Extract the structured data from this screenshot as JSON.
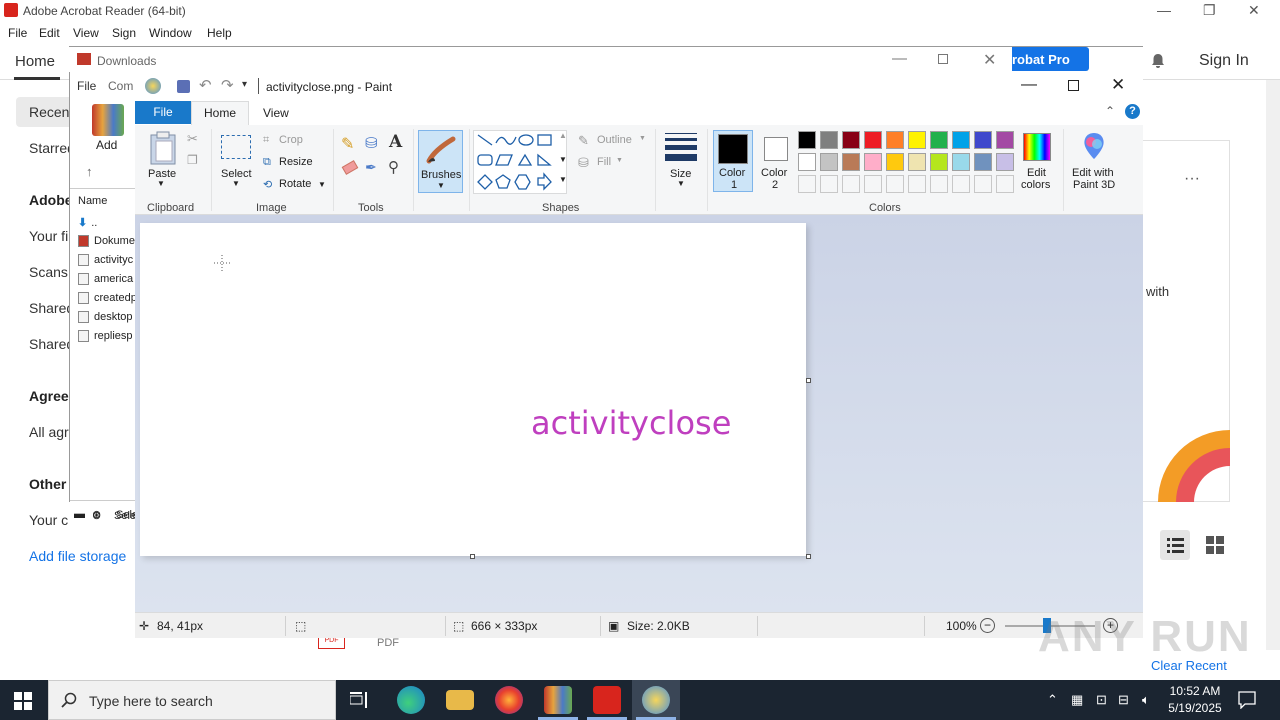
{
  "acrobat": {
    "window_title": "Adobe Acrobat Reader (64-bit)",
    "menu": [
      "File",
      "Edit",
      "View",
      "Sign",
      "Window",
      "Help"
    ],
    "home_tab": "Home",
    "try_pro": "robat Pro",
    "sign_in": "Sign In",
    "sidebar": {
      "recent": "Recent",
      "starred": "Starred",
      "adobe_head": "Adobe",
      "your_files": "Your fi",
      "scans": "Scans",
      "shared1": "Shared",
      "shared2": "Shared",
      "agree_head": "Agree",
      "all_agree": "All agr",
      "other_head": "Other",
      "your_c": "Your c",
      "add_storage": "Add file storage"
    },
    "right_text": "with",
    "more": "···",
    "clear_recent": "Clear Recent",
    "pdf_badge": "PDF",
    "pdf_label": "PDF"
  },
  "explorer": {
    "title": "Downloads",
    "menu_file": "File",
    "menu_com": "Com",
    "add_label": "Add",
    "name_header": "Name",
    "rows": [
      "..",
      "Dokume",
      "activityc",
      "america",
      "createdp",
      "desktop",
      "repliesp"
    ],
    "status": "Sele"
  },
  "paint": {
    "title": "activityclose.png - Paint",
    "tabs": {
      "file": "File",
      "home": "Home",
      "view": "View"
    },
    "clipboard": {
      "paste": "Paste",
      "label": "Clipboard"
    },
    "image": {
      "select": "Select",
      "crop": "Crop",
      "resize": "Resize",
      "rotate": "Rotate",
      "label": "Image"
    },
    "tools": {
      "label": "Tools"
    },
    "brushes": "Brushes",
    "shapes": {
      "outline": "Outline",
      "fill": "Fill",
      "label": "Shapes"
    },
    "size": "Size",
    "color1": "Color\n1",
    "color1_a": "Color",
    "color1_b": "1",
    "color2_a": "Color",
    "color2_b": "2",
    "colors_label": "Colors",
    "edit_colors_a": "Edit",
    "edit_colors_b": "colors",
    "edit3d_a": "Edit with",
    "edit3d_b": "Paint 3D",
    "palette_row1": [
      "#000000",
      "#7f7f7f",
      "#880015",
      "#ed1c24",
      "#ff7f27",
      "#fff200",
      "#22b14c",
      "#00a2e8",
      "#3f48cc",
      "#a349a4"
    ],
    "palette_row2": [
      "#ffffff",
      "#c3c3c3",
      "#b97a57",
      "#ffaec9",
      "#ffc90e",
      "#efe4b0",
      "#b5e61d",
      "#99d9ea",
      "#7092be",
      "#c8bfe7"
    ],
    "canvas_text": "activityclose",
    "canvas_text_color": "#bf3fbf",
    "status": {
      "cursor_pos": "84, 41px",
      "image_size": "666 × 333px",
      "file_size": "Size: 2.0KB",
      "zoom": "100%"
    }
  },
  "watermark": "ANY RUN",
  "taskbar": {
    "search_placeholder": "Type here to search",
    "time": "10:52 AM",
    "date": "5/19/2025"
  }
}
